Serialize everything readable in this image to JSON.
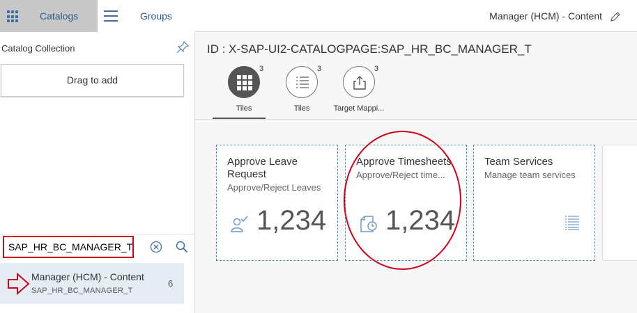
{
  "tabs": {
    "catalogs": "Catalogs",
    "groups": "Groups"
  },
  "sidebar": {
    "collection_title": "Catalog Collection",
    "drag_label": "Drag to add",
    "search_value": "SAP_HR_BC_MANAGER_T",
    "result": {
      "title": "Manager (HCM) - Content",
      "id": "SAP_HR_BC_MANAGER_T",
      "count": "6"
    }
  },
  "header": {
    "title": "Manager (HCM) - Content"
  },
  "catalog": {
    "id_label": "ID : X-SAP-UI2-CATALOGPAGE:SAP_HR_BC_MANAGER_T",
    "icon_tabs": [
      {
        "label": "Tiles",
        "count": "3",
        "icon": "grid-icon"
      },
      {
        "label": "Tiles",
        "count": "3",
        "icon": "list-icon"
      },
      {
        "label": "Target Mappi...",
        "count": "3",
        "icon": "share-icon"
      }
    ]
  },
  "tiles": [
    {
      "title": "Approve Leave Request",
      "subtitle": "Approve/Reject Leaves",
      "number": "1,234",
      "icon": "employee-approve-icon"
    },
    {
      "title": "Approve Timesheets",
      "subtitle": "Approve/Reject time...",
      "number": "1,234",
      "icon": "timesheet-icon"
    },
    {
      "title": "Team Services",
      "subtitle": "Manage team services",
      "number": "",
      "icon": "list-icon"
    }
  ],
  "colors": {
    "accent": "#3f6fa5",
    "highlight": "#d0021b",
    "tile_border": "#4a90c2"
  }
}
